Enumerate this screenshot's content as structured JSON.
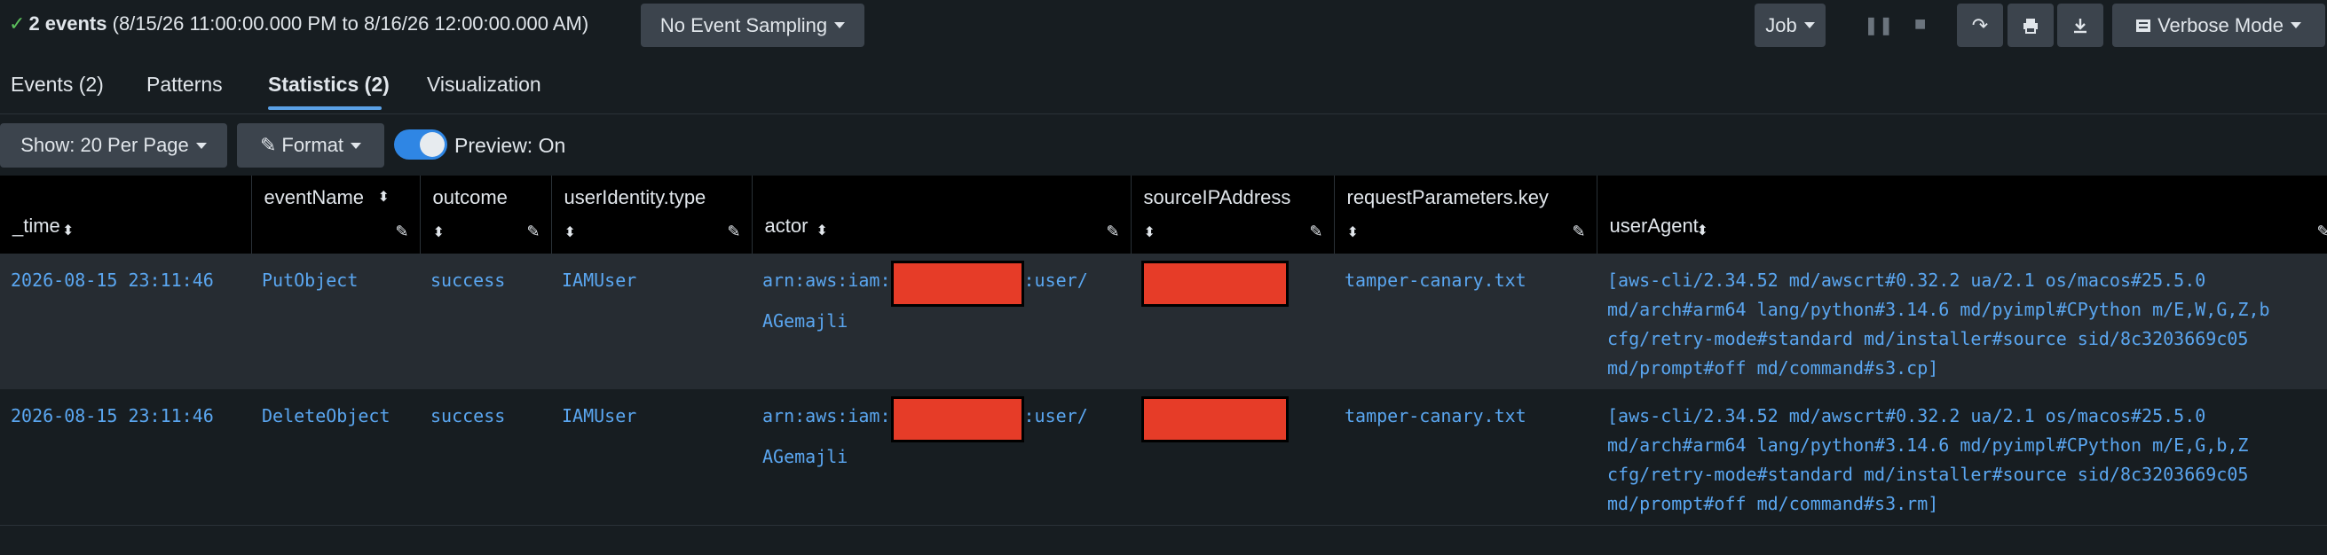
{
  "status": {
    "count_label": "2 events",
    "range_label": "(8/15/26 11:00:00.000 PM to 8/16/26 12:00:00.000 AM)"
  },
  "sampling_label": "No Event Sampling",
  "job_label": "Job",
  "mode_label": "Verbose Mode",
  "tabs": [
    {
      "label": "Events (2)"
    },
    {
      "label": "Patterns"
    },
    {
      "label": "Statistics (2)"
    },
    {
      "label": "Visualization"
    }
  ],
  "toolbar": {
    "show_label": "Show: 20 Per Page",
    "format_label": "Format",
    "preview_label": "Preview: On"
  },
  "columns": [
    "_time",
    "eventName",
    "outcome",
    "userIdentity.type",
    "actor",
    "sourceIPAddress",
    "requestParameters.key",
    "userAgent"
  ],
  "rows": [
    {
      "time": "2026-08-15 23:11:46",
      "eventName": "PutObject",
      "outcome": "success",
      "userIdentityType": "IAMUser",
      "actor_prefix": "arn:aws:iam:",
      "actor_suffix": ":user/",
      "actor_name": "AGemajli",
      "key": "tamper-canary.txt",
      "userAgent": "[aws-cli/2.34.52 md/awscrt#0.32.2 ua/2.1 os/macos#25.5.0 md/arch#arm64 lang/python#3.14.6 md/pyimpl#CPython m/E,W,G,Z,b cfg/retry-mode#standard md/installer#source sid/8c3203669c05 md/prompt#off md/command#s3.cp]"
    },
    {
      "time": "2026-08-15 23:11:46",
      "eventName": "DeleteObject",
      "outcome": "success",
      "userIdentityType": "IAMUser",
      "actor_prefix": "arn:aws:iam:",
      "actor_suffix": ":user/",
      "actor_name": "AGemajli",
      "key": "tamper-canary.txt",
      "userAgent": "[aws-cli/2.34.52 md/awscrt#0.32.2 ua/2.1 os/macos#25.5.0 md/arch#arm64 lang/python#3.14.6 md/pyimpl#CPython m/E,G,b,Z cfg/retry-mode#standard md/installer#source sid/8c3203669c05 md/prompt#off md/command#s3.rm]"
    }
  ],
  "colors": {
    "background": "#171d21",
    "link_text": "#5aa6f0",
    "redaction": "#e63c28",
    "toggle_on": "#2f86e4",
    "active_tab": "#5aa0e6"
  }
}
